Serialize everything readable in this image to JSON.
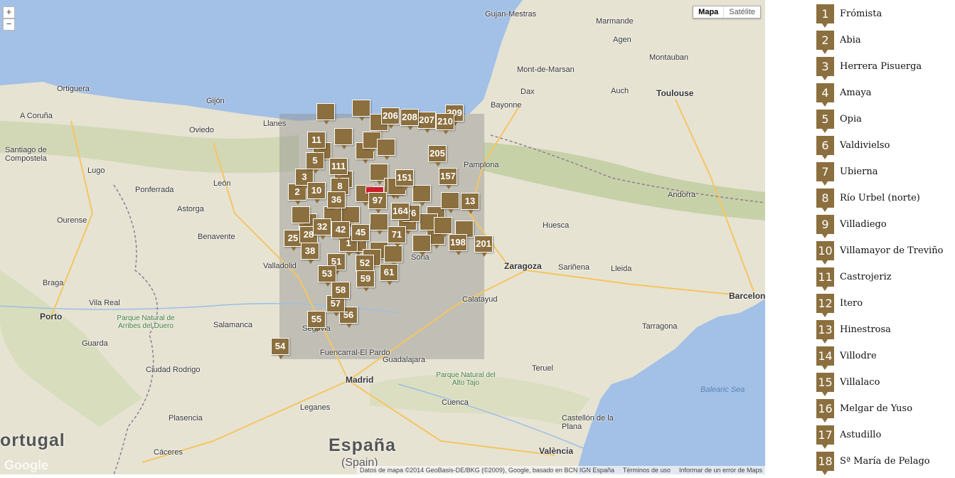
{
  "map": {
    "zoom_in": "+",
    "zoom_out": "−",
    "maptype": [
      "Mapa",
      "Satélite"
    ],
    "footer": [
      "Datos de mapa ©2014 GeoBasis-DE/BKG (©2009), Google, basado en BCN IGN España",
      "Términos de uso",
      "Informar de un error de Maps"
    ],
    "brand": "Google",
    "labels": {
      "country_es": "España",
      "country_es2": "(Spain)",
      "portugal": "ortugal",
      "balearic": "Balearic Sea",
      "madrid": "Madrid",
      "toulouse": "Toulouse",
      "barcelona": "Barcelon",
      "zaragoza": "Zaragoza",
      "valladolid": "Valladolid",
      "salamanca": "Salamanca",
      "leon": "León",
      "oviedo": "Oviedo",
      "gijon": "Gijón",
      "acoruna": "A Coruña",
      "santiago": "Santiago de Compostela",
      "bayonne": "Bayonne",
      "pamplona": "Pamplona",
      "soria": "Soria",
      "valencia": "València",
      "andorra": "Andorra",
      "leganes": "Leganes",
      "caceres": "Cáceres",
      "plasencia": "Plasencia",
      "guadalajara": "Guadalajara",
      "tarragona": "Tarragona",
      "lleida": "Lleida",
      "huesca": "Huesca",
      "ourense": "Ourense",
      "ponferrada": "Ponferrada",
      "astorga": "Astorga",
      "benavente": "Benavente",
      "porto": "Porto",
      "vilareal": "Vila Real",
      "guarda": "Guarda",
      "braga": "Braga",
      "auch": "Auch",
      "agen": "Agen",
      "montauban": "Montauban",
      "marmande": "Marmande",
      "dax": "Dax",
      "mont_de_marsan": "Mont-de-Marsan",
      "gujan": "Gujan-Mestras",
      "teruel": "Teruel",
      "cuenca": "Cuenca",
      "castellon": "Castellón de la Plana",
      "calatayud": "Calatayud",
      "ortiguera": "Ortiguera",
      "lugo": "Lugo",
      "llanes": "Llanes",
      "sabinanigo": "Sariñena",
      "park_duero": "Parque Natural de Arribes del Duero",
      "park_tajo": "Parque Natural del Alto Tajo",
      "ciudad_rodrigo": "Ciudad Rodrigo",
      "segovia": "Segovia",
      "fuencarral": "Fuencarral-El Pardo"
    },
    "markers": [
      "1",
      "2",
      "3",
      "5",
      "8",
      "10",
      "11",
      "13",
      "25",
      "28",
      "32",
      "36",
      "38",
      "42",
      "45",
      "51",
      "52",
      "53",
      "54",
      "55",
      "56",
      "57",
      "58",
      "59",
      "61",
      "71",
      "76",
      "97",
      "111",
      "151",
      "157",
      "164",
      "198",
      "201",
      "205",
      "206",
      "207",
      "208",
      "209",
      "210"
    ]
  },
  "list": [
    {
      "num": "1",
      "name": "Frómista"
    },
    {
      "num": "2",
      "name": "Abia"
    },
    {
      "num": "3",
      "name": "Herrera Pisuerga"
    },
    {
      "num": "4",
      "name": "Amaya"
    },
    {
      "num": "5",
      "name": "Opia"
    },
    {
      "num": "6",
      "name": "Valdivielso"
    },
    {
      "num": "7",
      "name": "Ubierna"
    },
    {
      "num": "8",
      "name": "Río Urbel (norte)"
    },
    {
      "num": "9",
      "name": "Villadiego"
    },
    {
      "num": "10",
      "name": "Villamayor de Treviño"
    },
    {
      "num": "11",
      "name": "Castrojeriz"
    },
    {
      "num": "12",
      "name": "Itero"
    },
    {
      "num": "13",
      "name": "Hinestrosa"
    },
    {
      "num": "14",
      "name": "Villodre"
    },
    {
      "num": "15",
      "name": "Villalaco"
    },
    {
      "num": "16",
      "name": "Melgar de Yuso"
    },
    {
      "num": "17",
      "name": "Astudillo"
    },
    {
      "num": "18",
      "name": "Sª María de Pelago"
    }
  ]
}
